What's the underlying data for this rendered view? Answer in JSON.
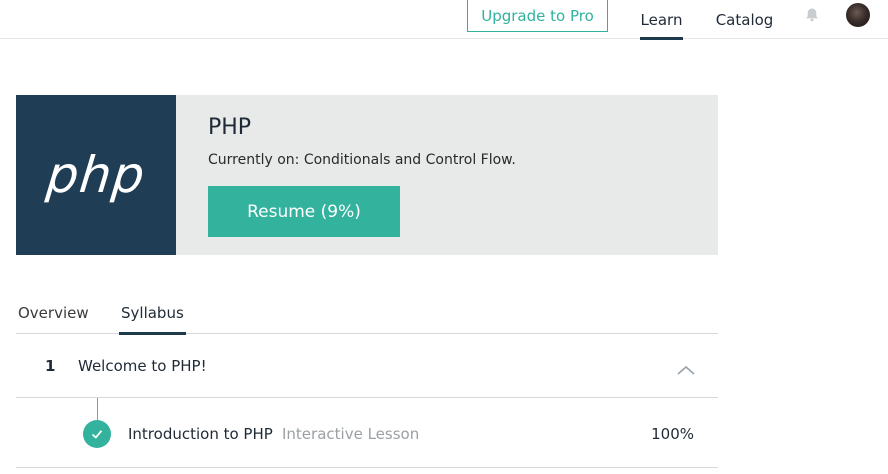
{
  "nav": {
    "upgrade_label": "Upgrade to Pro",
    "learn_label": "Learn",
    "catalog_label": "Catalog",
    "bell_icon": "bell-icon",
    "avatar_icon": "user-avatar"
  },
  "course": {
    "logo_text": "php",
    "title": "PHP",
    "current": "Currently on: Conditionals and Control Flow.",
    "resume_label": "Resume (9%)",
    "progress_percent": 9
  },
  "tabs": [
    {
      "label": "Overview",
      "active": false
    },
    {
      "label": "Syllabus",
      "active": true
    }
  ],
  "syllabus": {
    "sections": [
      {
        "number": "1",
        "title": "Welcome to PHP!",
        "expanded": true,
        "lessons": [
          {
            "title": "Introduction to PHP",
            "type": "Interactive Lesson",
            "progress": "100%",
            "completed": true
          }
        ]
      }
    ]
  },
  "colors": {
    "accent": "#33b29e",
    "navy": "#1f3d54",
    "card_bg": "#e8e9e9"
  }
}
